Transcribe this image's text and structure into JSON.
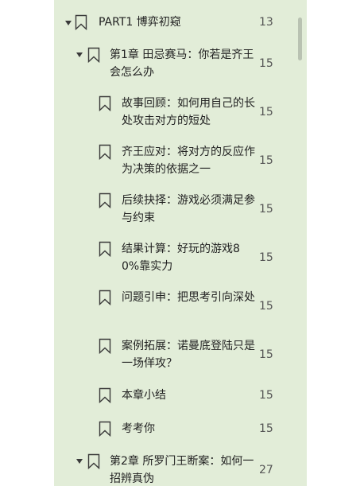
{
  "toc": {
    "items": [
      {
        "title": "PART1 博弈初窥",
        "page": "13",
        "level": 0,
        "expanded": true
      },
      {
        "title": "第1章 田忌赛马：你若是齐王会怎么办",
        "page": "15",
        "level": 1,
        "expanded": true
      },
      {
        "title": "故事回顾：如何用自己的长处攻击对方的短处",
        "page": "15",
        "level": 2
      },
      {
        "title": "齐王应对：将对方的反应作为决策的依据之一",
        "page": "15",
        "level": 2
      },
      {
        "title": "后续抉择：游戏必须满足参与约束",
        "page": "15",
        "level": 2
      },
      {
        "title": "结果计算：好玩的游戏80%靠实力",
        "page": "15",
        "level": 2
      },
      {
        "title": "问题引申：把思考引向深处",
        "page": "15",
        "level": 2
      },
      {
        "title": "案例拓展：诺曼底登陆只是一场佯攻？",
        "page": "15",
        "level": 2
      },
      {
        "title": "本章小结",
        "page": "15",
        "level": 2
      },
      {
        "title": "考考你",
        "page": "15",
        "level": 2
      },
      {
        "title": "第2章 所罗门王断案：如何一招辨真伪",
        "page": "27",
        "level": 1,
        "expanded": true
      }
    ]
  },
  "colors": {
    "panel_bg": "#e2edd8",
    "text": "#222222",
    "page_text": "#555555",
    "icon_stroke": "#3a3a3a"
  },
  "icons": {
    "bookmark": "bookmark-icon",
    "expand": "expand-arrow-icon"
  }
}
